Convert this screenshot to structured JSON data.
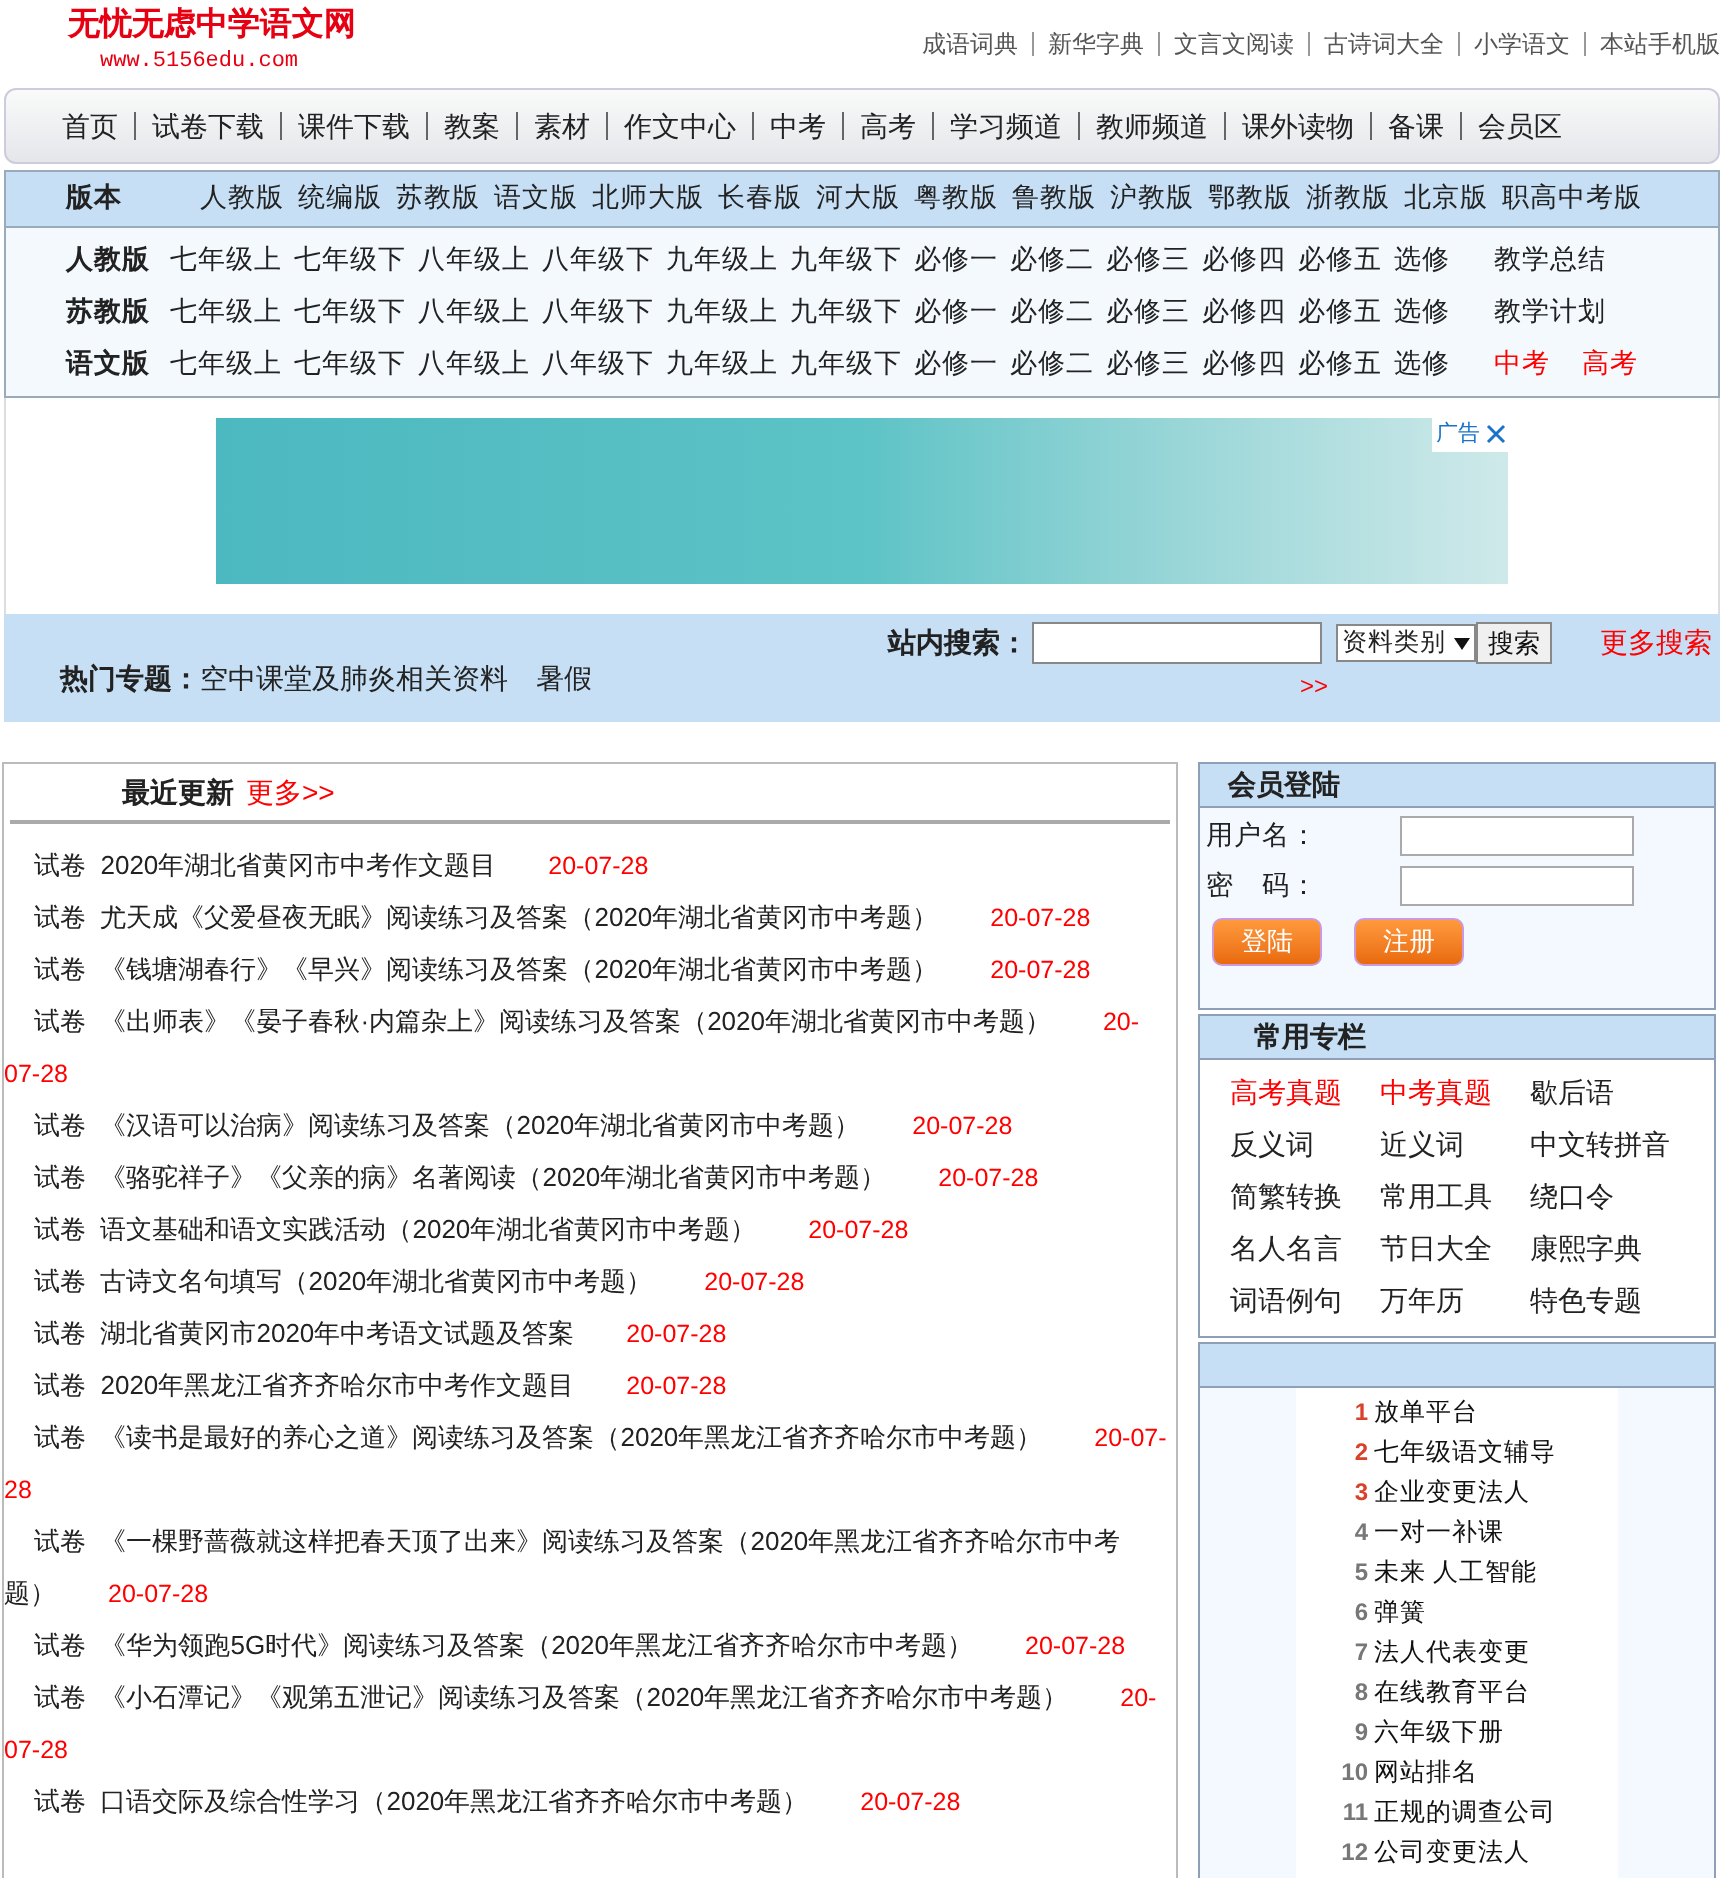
{
  "site": {
    "title": "无忧无虑中学语文网",
    "url": "www.5156edu.com"
  },
  "top_links": [
    "成语词典",
    "新华字典",
    "文言文阅读",
    "古诗词大全",
    "小学语文",
    "本站手机版"
  ],
  "nav": [
    "首页",
    "试卷下载",
    "课件下载",
    "教案",
    "素材",
    "作文中心",
    "中考",
    "高考",
    "学习频道",
    "教师频道",
    "课外读物",
    "备课",
    "会员区"
  ],
  "versions": {
    "label": "版本",
    "items": [
      "人教版",
      "统编版",
      "苏教版",
      "语文版",
      "北师大版",
      "长春版",
      "河大版",
      "粤教版",
      "鲁教版",
      "沪教版",
      "鄂教版",
      "浙教版",
      "北京版",
      "职高中考版"
    ]
  },
  "grade_rows": [
    {
      "label": "人教版",
      "items": [
        "七年级上",
        "七年级下",
        "八年级上",
        "八年级下",
        "九年级上",
        "九年级下",
        "必修一",
        "必修二",
        "必修三",
        "必修四",
        "必修五",
        "选修"
      ],
      "extras": [
        {
          "text": "教学总结",
          "highlighted": false
        }
      ]
    },
    {
      "label": "苏教版",
      "items": [
        "七年级上",
        "七年级下",
        "八年级上",
        "八年级下",
        "九年级上",
        "九年级下",
        "必修一",
        "必修二",
        "必修三",
        "必修四",
        "必修五",
        "选修"
      ],
      "extras": [
        {
          "text": "教学计划",
          "highlighted": false
        }
      ]
    },
    {
      "label": "语文版",
      "items": [
        "七年级上",
        "七年级下",
        "八年级上",
        "八年级下",
        "九年级上",
        "九年级下",
        "必修一",
        "必修二",
        "必修三",
        "必修四",
        "必修五",
        "选修"
      ],
      "extras": [
        {
          "text": "中考",
          "highlighted": true
        },
        {
          "text": "高考",
          "highlighted": true
        }
      ]
    }
  ],
  "ad": {
    "label": "广告"
  },
  "hot_topics": {
    "label": "热门专题：",
    "items": [
      "空中课堂及肺炎相关资料",
      "暑假"
    ]
  },
  "search": {
    "label": "站内搜索：",
    "category": "资料类别",
    "button": "搜索",
    "more": "更多搜索",
    "more_arrows": ">>"
  },
  "recent": {
    "title": "最近更新",
    "more": "更多>>",
    "items": [
      {
        "tag": "试卷",
        "title": "2020年湖北省黄冈市中考作文题目",
        "date": "20-07-28"
      },
      {
        "tag": "试卷",
        "title": "尤天成《父爱昼夜无眠》阅读练习及答案（2020年湖北省黄冈市中考题）",
        "date": "20-07-28"
      },
      {
        "tag": "试卷",
        "title": "《钱塘湖春行》《早兴》阅读练习及答案（2020年湖北省黄冈市中考题）",
        "date": "20-07-28"
      },
      {
        "tag": "试卷",
        "title": "《出师表》《晏子春秋·内篇杂上》阅读练习及答案（2020年湖北省黄冈市中考题）",
        "date": "20-07-28"
      },
      {
        "tag": "试卷",
        "title": "《汉语可以治病》阅读练习及答案（2020年湖北省黄冈市中考题）",
        "date": "20-07-28"
      },
      {
        "tag": "试卷",
        "title": "《骆驼祥子》《父亲的病》名著阅读（2020年湖北省黄冈市中考题）",
        "date": "20-07-28"
      },
      {
        "tag": "试卷",
        "title": "语文基础和语文实践活动（2020年湖北省黄冈市中考题）",
        "date": "20-07-28"
      },
      {
        "tag": "试卷",
        "title": "古诗文名句填写（2020年湖北省黄冈市中考题）",
        "date": "20-07-28"
      },
      {
        "tag": "试卷",
        "title": "湖北省黄冈市2020年中考语文试题及答案",
        "date": "20-07-28"
      },
      {
        "tag": "试卷",
        "title": "2020年黑龙江省齐齐哈尔市中考作文题目",
        "date": "20-07-28"
      },
      {
        "tag": "试卷",
        "title": "《读书是最好的养心之道》阅读练习及答案（2020年黑龙江省齐齐哈尔市中考题）",
        "date": "20-07-28"
      },
      {
        "tag": "试卷",
        "title": "《一棵野蔷薇就这样把春天顶了出来》阅读练习及答案（2020年黑龙江省齐齐哈尔市中考题）",
        "date": "20-07-28"
      },
      {
        "tag": "试卷",
        "title": "《华为领跑5G时代》阅读练习及答案（2020年黑龙江省齐齐哈尔市中考题）",
        "date": "20-07-28"
      },
      {
        "tag": "试卷",
        "title": "《小石潭记》《观第五泄记》阅读练习及答案（2020年黑龙江省齐齐哈尔市中考题）",
        "date": "20-07-28"
      },
      {
        "tag": "试卷",
        "title": "口语交际及综合性学习（2020年黑龙江省齐齐哈尔市中考题）",
        "date": "20-07-28"
      }
    ]
  },
  "login": {
    "title": "会员登陆",
    "username_label": "用户名：",
    "password_label": "密　码：",
    "login_button": "登陆",
    "register_button": "注册"
  },
  "columns": {
    "title": "常用专栏",
    "items": [
      {
        "text": "高考真题",
        "highlighted": true
      },
      {
        "text": "中考真题",
        "highlighted": true
      },
      {
        "text": "歇后语",
        "highlighted": false
      },
      {
        "text": "反义词",
        "highlighted": false
      },
      {
        "text": "近义词",
        "highlighted": false
      },
      {
        "text": "中文转拼音",
        "highlighted": false
      },
      {
        "text": "简繁转换",
        "highlighted": false
      },
      {
        "text": "常用工具",
        "highlighted": false
      },
      {
        "text": "绕口令",
        "highlighted": false
      },
      {
        "text": "名人名言",
        "highlighted": false
      },
      {
        "text": "节日大全",
        "highlighted": false
      },
      {
        "text": "康熙字典",
        "highlighted": false
      },
      {
        "text": "词语例句",
        "highlighted": false
      },
      {
        "text": "万年历",
        "highlighted": false
      },
      {
        "text": "特色专题",
        "highlighted": false
      }
    ]
  },
  "ranking": [
    {
      "rank": "1",
      "text": "放单平台",
      "color": "#d9412b"
    },
    {
      "rank": "2",
      "text": "七年级语文辅导",
      "color": "#d9412b"
    },
    {
      "rank": "3",
      "text": "企业变更法人",
      "color": "#d9412b"
    },
    {
      "rank": "4",
      "text": "一对一补课",
      "color": "#777777"
    },
    {
      "rank": "5",
      "text": "未来 人工智能",
      "color": "#777777"
    },
    {
      "rank": "6",
      "text": "弹簧",
      "color": "#777777"
    },
    {
      "rank": "7",
      "text": "法人代表变更",
      "color": "#777777"
    },
    {
      "rank": "8",
      "text": "在线教育平台",
      "color": "#777777"
    },
    {
      "rank": "9",
      "text": "六年级下册",
      "color": "#777777"
    },
    {
      "rank": "10",
      "text": "网站排名",
      "color": "#777777"
    },
    {
      "rank": "11",
      "text": "正规的调查公司",
      "color": "#777777"
    },
    {
      "rank": "12",
      "text": "公司变更法人",
      "color": "#777777"
    }
  ]
}
